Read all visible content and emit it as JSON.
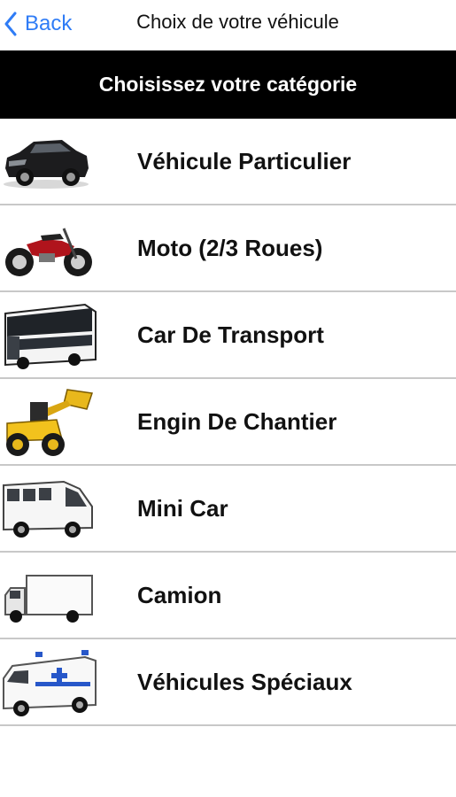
{
  "nav": {
    "back_label": "Back",
    "title": "Choix de votre véhicule"
  },
  "header": {
    "title": "Choisissez votre catégorie"
  },
  "categories": [
    {
      "label": "Véhicule Particulier",
      "icon": "car-icon"
    },
    {
      "label": "Moto (2/3 Roues)",
      "icon": "motorcycle-icon"
    },
    {
      "label": "Car De Transport",
      "icon": "bus-icon"
    },
    {
      "label": "Engin De Chantier",
      "icon": "loader-icon"
    },
    {
      "label": "Mini Car",
      "icon": "minibus-icon"
    },
    {
      "label": "Camion",
      "icon": "truck-icon"
    },
    {
      "label": "Véhicules Spéciaux",
      "icon": "ambulance-icon"
    }
  ],
  "colors": {
    "accent": "#2f7cf6",
    "header_bg": "#000000",
    "separator": "#c8c8c8"
  }
}
